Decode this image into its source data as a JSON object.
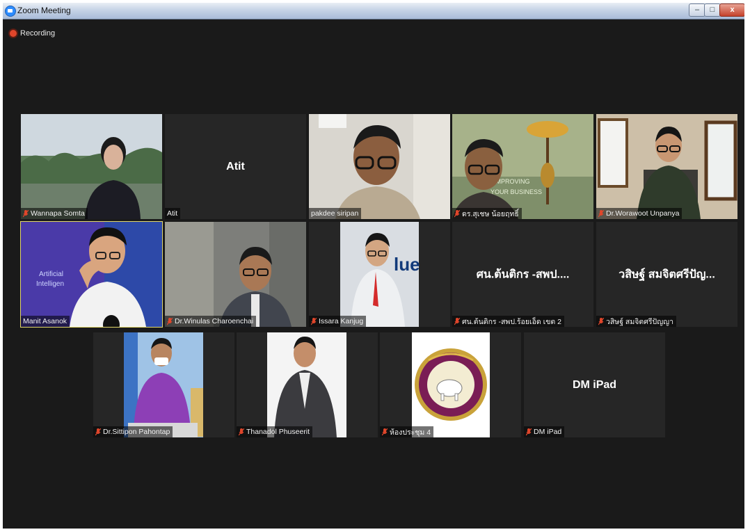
{
  "window": {
    "title": "Zoom Meeting",
    "recording_label": "Recording",
    "controls": {
      "minimize": "–",
      "maximize": "□",
      "close": "x"
    }
  },
  "colors": {
    "active_speaker_border": "#e2d86a",
    "mic_muted": "#e0462b",
    "recording": "#e0462b"
  },
  "participants": [
    {
      "id": "p1",
      "name": "Wannapa Somta",
      "muted": true
    },
    {
      "id": "p2",
      "name": "Atit",
      "center_name": "Atit",
      "muted": false
    },
    {
      "id": "p3",
      "name": "pakdee siripan",
      "muted": false
    },
    {
      "id": "p4",
      "name": "ดร.สุเชษ น้อยฤทธิ์",
      "muted": true,
      "background_text": [
        "IMPROVING",
        "YOUR BUSINESS"
      ]
    },
    {
      "id": "p5",
      "name": "Dr.Worawoot Unpanya",
      "muted": true
    },
    {
      "id": "p6",
      "name": "Manit Asanok",
      "muted": false,
      "active_speaker": true,
      "background_text": [
        "Artificial",
        "Intelligen"
      ]
    },
    {
      "id": "p7",
      "name": "Dr.Winulas Charoenchai",
      "muted": true
    },
    {
      "id": "p8",
      "name": "Issara Kanjug",
      "muted": true,
      "background_text": [
        "lue"
      ]
    },
    {
      "id": "p9",
      "name": "ศน.ต้นติกร -สพป.ร้อยเอ็ด เขต 2",
      "center_name": "ศน.ต้นติกร -สพป....",
      "muted": true
    },
    {
      "id": "p10",
      "name": "วสิษฐ์ สมจิตศรีปัญญา",
      "center_name": "วสิษฐ์ สมจิตศรีปัญ...",
      "muted": true
    },
    {
      "id": "p11",
      "name": "Dr.Sittipon Pahontap",
      "muted": true
    },
    {
      "id": "p12",
      "name": "Thanadol Phuseerit",
      "muted": true
    },
    {
      "id": "p13",
      "name": "ห้องประชุม 4",
      "muted": true
    },
    {
      "id": "p14",
      "name": "DM iPad",
      "center_name": "DM iPad",
      "muted": true
    }
  ]
}
